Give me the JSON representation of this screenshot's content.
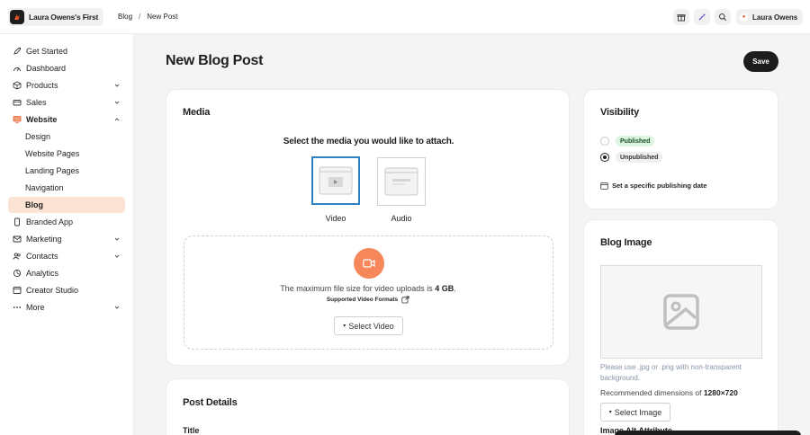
{
  "app": {
    "brand_name": "Laura Owens's First",
    "user_name": "Laura Owens"
  },
  "breadcrumb": {
    "parent": "Blog",
    "separator": "/",
    "current": "New Post"
  },
  "toolbar_icons": [
    "gift-icon",
    "magic-wand-icon",
    "search-icon"
  ],
  "sidebar": {
    "items": [
      {
        "label": "Get Started",
        "icon": "rocket-icon"
      },
      {
        "label": "Dashboard",
        "icon": "dashboard-icon"
      },
      {
        "label": "Products",
        "icon": "box-icon",
        "chevron": "down"
      },
      {
        "label": "Sales",
        "icon": "wallet-icon",
        "chevron": "down"
      },
      {
        "label": "Website",
        "icon": "monitor-icon",
        "chevron": "up",
        "expanded": true
      },
      {
        "label": "Design"
      },
      {
        "label": "Website Pages"
      },
      {
        "label": "Landing Pages"
      },
      {
        "label": "Navigation"
      },
      {
        "label": "Blog",
        "active": true
      },
      {
        "label": "Branded App",
        "icon": "phone-icon"
      },
      {
        "label": "Marketing",
        "icon": "mail-icon",
        "chevron": "down"
      },
      {
        "label": "Contacts",
        "icon": "users-icon",
        "chevron": "down"
      },
      {
        "label": "Analytics",
        "icon": "chart-icon"
      },
      {
        "label": "Creator Studio",
        "icon": "studio-icon"
      },
      {
        "label": "More",
        "icon": "dots-icon",
        "chevron": "down"
      }
    ]
  },
  "page": {
    "title": "New Blog Post",
    "save_label": "Save"
  },
  "media": {
    "title": "Media",
    "prompt": "Select the media you would like to attach.",
    "options": [
      {
        "label": "Video",
        "selected": true
      },
      {
        "label": "Audio",
        "selected": false
      }
    ],
    "note_prefix": "The maximum file size for video uploads is ",
    "note_size": "4 GB",
    "note_suffix": ".",
    "formats_link": "Supported Video Formats",
    "select_button": "Select Video"
  },
  "visibility": {
    "title": "Visibility",
    "options": [
      {
        "label": "Published",
        "selected": false
      },
      {
        "label": "Unpublished",
        "selected": true
      }
    ],
    "schedule_link": "Set a specific publishing date"
  },
  "blog_image": {
    "title": "Blog Image",
    "hint": "Please use .jpg or .png with non-transparent background.",
    "recommended_prefix": "Recommended dimensions of ",
    "recommended_value": "1280×720",
    "select_button": "Select Image",
    "alt_label": "Image Alt Attribute"
  },
  "post_details": {
    "title": "Post Details",
    "field_title": "Title"
  },
  "colors": {
    "accent": "#f5875a",
    "selected_border": "#2f7fc1",
    "active_nav": "#fde3d4",
    "published_pill": "#dcf5df"
  }
}
